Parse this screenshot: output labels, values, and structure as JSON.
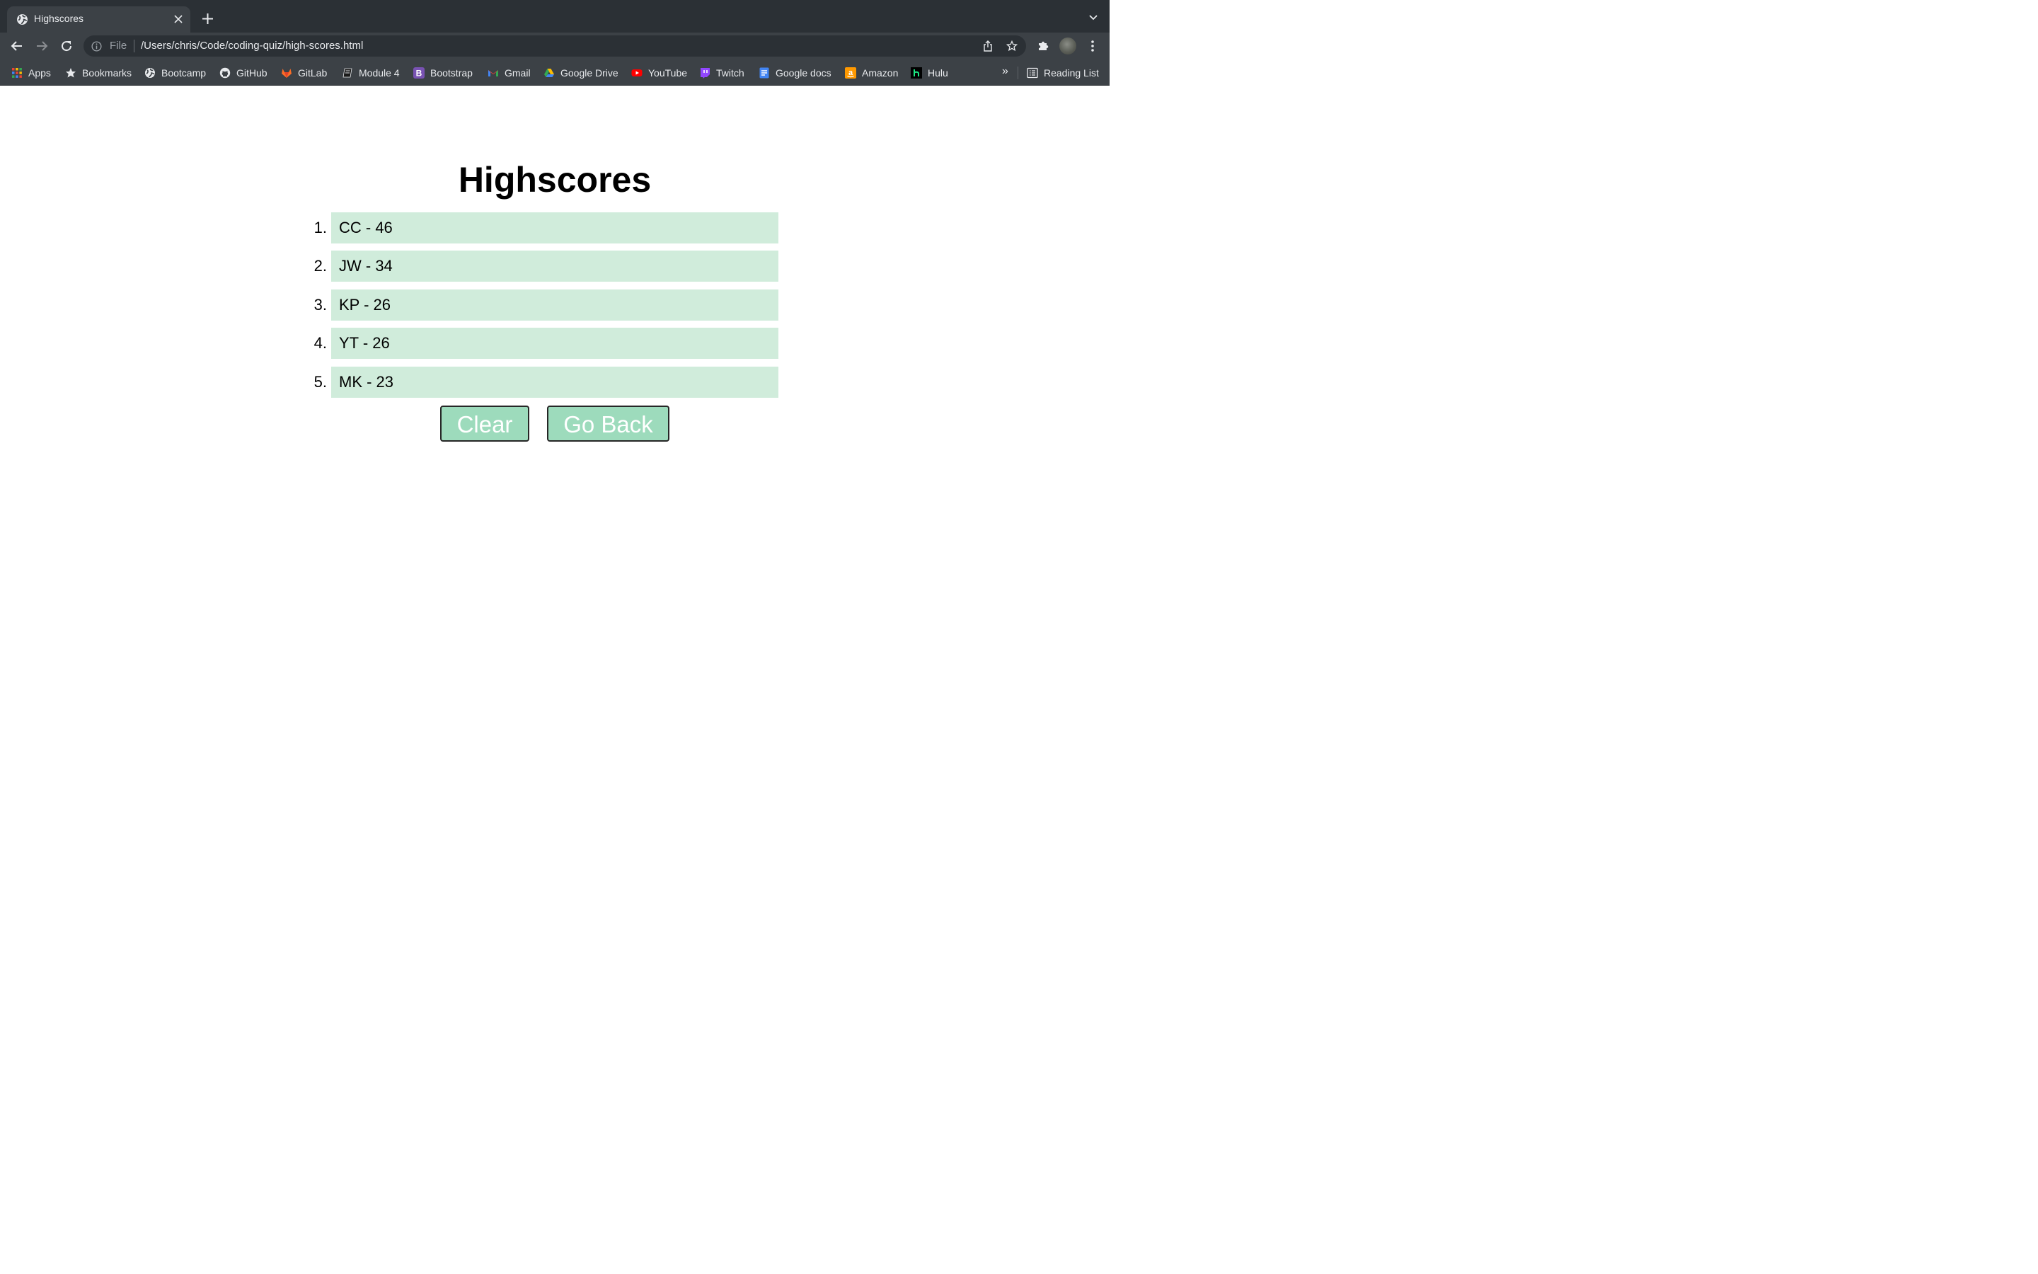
{
  "browser": {
    "tab": {
      "title": "Highscores"
    },
    "address": {
      "scheme": "File",
      "url": "/Users/chris/Code/coding-quiz/high-scores.html"
    },
    "bookmarks": [
      {
        "label": "Apps",
        "icon": "apps-grid-icon"
      },
      {
        "label": "Bookmarks",
        "icon": "star-icon"
      },
      {
        "label": "Bootcamp",
        "icon": "globe-icon"
      },
      {
        "label": "GitHub",
        "icon": "github-icon"
      },
      {
        "label": "GitLab",
        "icon": "gitlab-icon"
      },
      {
        "label": "Module 4",
        "icon": "book-icon"
      },
      {
        "label": "Bootstrap",
        "icon": "bootstrap-icon"
      },
      {
        "label": "Gmail",
        "icon": "gmail-icon"
      },
      {
        "label": "Google Drive",
        "icon": "google-drive-icon"
      },
      {
        "label": "YouTube",
        "icon": "youtube-icon"
      },
      {
        "label": "Twitch",
        "icon": "twitch-icon"
      },
      {
        "label": "Google docs",
        "icon": "google-docs-icon"
      },
      {
        "label": "Amazon",
        "icon": "amazon-icon"
      },
      {
        "label": "Hulu",
        "icon": "hulu-icon"
      }
    ],
    "overflow_label": "»",
    "reading_list": "Reading List"
  },
  "page": {
    "title": "Highscores",
    "scores": [
      {
        "rank": "1.",
        "entry": "CC - 46"
      },
      {
        "rank": "2.",
        "entry": "JW - 34"
      },
      {
        "rank": "3.",
        "entry": "KP - 26"
      },
      {
        "rank": "4.",
        "entry": "YT - 26"
      },
      {
        "rank": "5.",
        "entry": "MK - 23"
      }
    ],
    "buttons": {
      "clear": "Clear",
      "go_back": "Go Back"
    }
  },
  "colors": {
    "score_background": "#d0ecdb",
    "button_background": "#9ddbbc",
    "chrome_dark": "#2b3035",
    "chrome_toolbar": "#3c4146"
  }
}
